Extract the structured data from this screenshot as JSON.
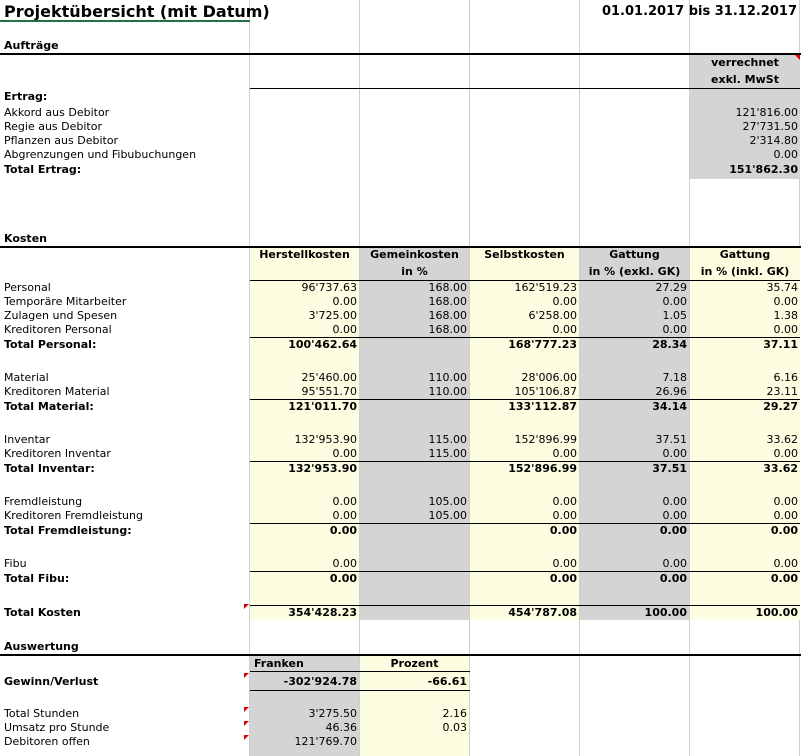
{
  "title": "Projektübersicht (mit Datum)",
  "date_range": "01.01.2017 bis 31.12.2017",
  "auftraege": {
    "section": "Aufträge",
    "header_line1": "verrechnet",
    "header_line2": "exkl. MwSt",
    "ertrag_label": "Ertrag:",
    "rows": [
      {
        "label": "Akkord aus Debitor",
        "value": "121'816.00"
      },
      {
        "label": "Regie aus Debitor",
        "value": "27'731.50"
      },
      {
        "label": "Pflanzen aus Debitor",
        "value": "2'314.80"
      },
      {
        "label": "Abgrenzungen und Fibubuchungen",
        "value": "0.00"
      }
    ],
    "total_label": "Total Ertrag:",
    "total_value": "151'862.30"
  },
  "kosten": {
    "section": "Kosten",
    "headers": {
      "h1": "Herstellkosten",
      "h2a": "Gemeinkosten",
      "h2b": "in %",
      "h3": "Selbstkosten",
      "h4a": "Gattung",
      "h4b": "in % (exkl. GK)",
      "h5a": "Gattung",
      "h5b": "in % (inkl. GK)"
    },
    "rows": [
      {
        "label": "Personal",
        "c1": "96'737.63",
        "c2": "168.00",
        "c3": "162'519.23",
        "c4": "27.29",
        "c5": "35.74"
      },
      {
        "label": "Temporäre Mitarbeiter",
        "c1": "0.00",
        "c2": "168.00",
        "c3": "0.00",
        "c4": "0.00",
        "c5": "0.00"
      },
      {
        "label": "Zulagen und Spesen",
        "c1": "3'725.00",
        "c2": "168.00",
        "c3": "6'258.00",
        "c4": "1.05",
        "c5": "1.38"
      },
      {
        "label": "Kreditoren Personal",
        "c1": "0.00",
        "c2": "168.00",
        "c3": "0.00",
        "c4": "0.00",
        "c5": "0.00"
      },
      {
        "label": "Total Personal:",
        "c1": "100'462.64",
        "c2": "",
        "c3": "168'777.23",
        "c4": "28.34",
        "c5": "37.11",
        "bold": true
      },
      {
        "label": "Material",
        "c1": "25'460.00",
        "c2": "110.00",
        "c3": "28'006.00",
        "c4": "7.18",
        "c5": "6.16"
      },
      {
        "label": "Kreditoren Material",
        "c1": "95'551.70",
        "c2": "110.00",
        "c3": "105'106.87",
        "c4": "26.96",
        "c5": "23.11"
      },
      {
        "label": "Total Material:",
        "c1": "121'011.70",
        "c2": "",
        "c3": "133'112.87",
        "c4": "34.14",
        "c5": "29.27",
        "bold": true
      },
      {
        "label": "Inventar",
        "c1": "132'953.90",
        "c2": "115.00",
        "c3": "152'896.99",
        "c4": "37.51",
        "c5": "33.62"
      },
      {
        "label": "Kreditoren Inventar",
        "c1": "0.00",
        "c2": "115.00",
        "c3": "0.00",
        "c4": "0.00",
        "c5": "0.00"
      },
      {
        "label": "Total Inventar:",
        "c1": "132'953.90",
        "c2": "",
        "c3": "152'896.99",
        "c4": "37.51",
        "c5": "33.62",
        "bold": true
      },
      {
        "label": "Fremdleistung",
        "c1": "0.00",
        "c2": "105.00",
        "c3": "0.00",
        "c4": "0.00",
        "c5": "0.00"
      },
      {
        "label": "Kreditoren Fremdleistung",
        "c1": "0.00",
        "c2": "105.00",
        "c3": "0.00",
        "c4": "0.00",
        "c5": "0.00"
      },
      {
        "label": "Total Fremdleistung:",
        "c1": "0.00",
        "c2": "",
        "c3": "0.00",
        "c4": "0.00",
        "c5": "0.00",
        "bold": true
      },
      {
        "label": "Fibu",
        "c1": "0.00",
        "c2": "",
        "c3": "0.00",
        "c4": "0.00",
        "c5": "0.00"
      },
      {
        "label": "Total Fibu:",
        "c1": "0.00",
        "c2": "",
        "c3": "0.00",
        "c4": "0.00",
        "c5": "0.00",
        "bold": true
      },
      {
        "label": "Total Kosten",
        "c1": "354'428.23",
        "c2": "",
        "c3": "454'787.08",
        "c4": "100.00",
        "c5": "100.00",
        "bold": true
      }
    ]
  },
  "auswertung": {
    "section": "Auswertung",
    "h_franken": "Franken",
    "h_prozent": "Prozent",
    "gewinn_label": "Gewinn/Verlust",
    "gewinn_franken": "-302'924.78",
    "gewinn_prozent": "-66.61",
    "rows": [
      {
        "label": "Total Stunden",
        "franken": "3'275.50",
        "prozent": "2.16"
      },
      {
        "label": "Umsatz pro Stunde",
        "franken": "46.36",
        "prozent": "0.03"
      },
      {
        "label": "Debitoren offen",
        "franken": "121'769.70",
        "prozent": ""
      }
    ]
  }
}
